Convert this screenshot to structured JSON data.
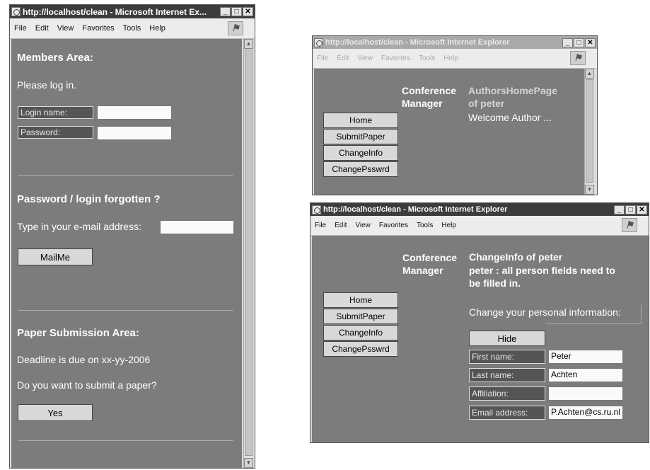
{
  "window_left": {
    "title": "http://localhost/clean - Microsoft Internet Ex...",
    "menu": [
      "File",
      "Edit",
      "View",
      "Favorites",
      "Tools",
      "Help"
    ],
    "members_heading": "Members Area:",
    "please_login": "Please log in.",
    "login_label": "Login name:",
    "password_label": "Password:",
    "forgot_heading": "Password / login forgotten ?",
    "email_prompt": "Type in your e-mail address:",
    "mailme_button": "MailMe",
    "submission_heading": "Paper Submission Area:",
    "deadline_text": "Deadline is due on xx-yy-2006",
    "submit_question": "Do you want to submit a paper?",
    "yes_button": "Yes"
  },
  "window_top_right": {
    "title": "http://localhost/clean - Microsoft Internet Explorer",
    "menu": [
      "File",
      "Edit",
      "View",
      "Favorites",
      "Tools",
      "Help"
    ],
    "nav": [
      "Home",
      "SubmitPaper",
      "ChangeInfo",
      "ChangePsswrd"
    ],
    "app_name_line1": "Conference",
    "app_name_line2": "Manager",
    "page_title_line1": "AuthorsHomePage",
    "page_title_line2": "of peter",
    "welcome": "Welcome Author ..."
  },
  "window_bottom_right": {
    "title": "http://localhost/clean - Microsoft Internet Explorer",
    "menu": [
      "File",
      "Edit",
      "View",
      "Favorites",
      "Tools",
      "Help"
    ],
    "nav": [
      "Home",
      "SubmitPaper",
      "ChangeInfo",
      "ChangePsswrd"
    ],
    "app_name_line1": "Conference",
    "app_name_line2": "Manager",
    "page_title": "ChangeInfo of peter",
    "message_line1": "peter : all person fields need to",
    "message_line2": "be filled in.",
    "instruction": "Change your personal information:",
    "hide_button": "Hide",
    "fields": [
      {
        "label": "First name:",
        "value": "Peter"
      },
      {
        "label": "Last name:",
        "value": "Achten"
      },
      {
        "label": "Affiliation:",
        "value": ""
      },
      {
        "label": "Email address:",
        "value": "P.Achten@cs.ru.nl"
      }
    ]
  }
}
